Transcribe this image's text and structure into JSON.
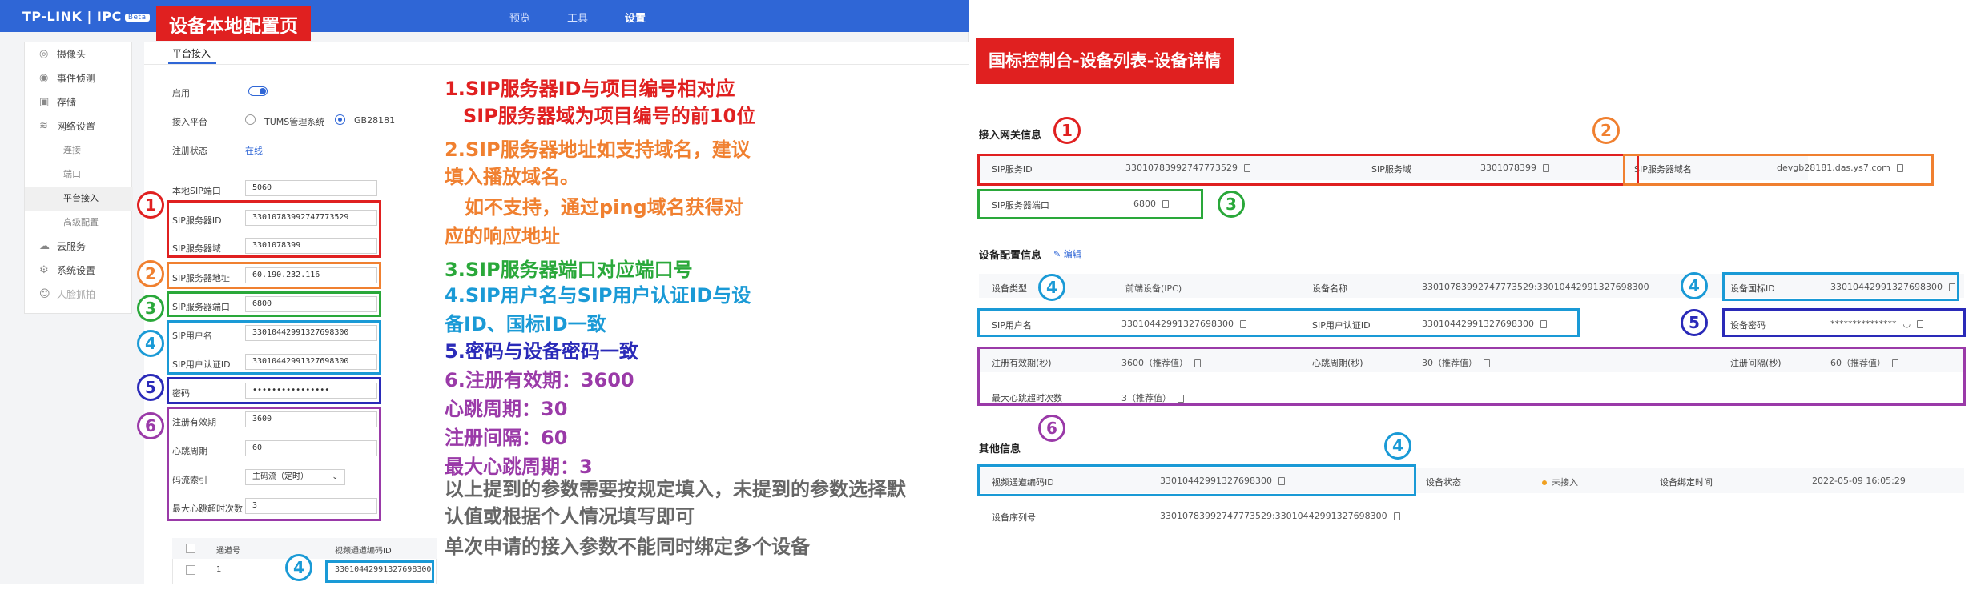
{
  "left": {
    "logo": "TP-LINK | IPC",
    "logo_badge": "Beta",
    "nav": [
      "预览",
      "工具",
      "设置"
    ],
    "title": "设备本地配置页",
    "sidebar": [
      "摄像头",
      "事件侦测",
      "存储",
      "网络设置",
      "连接",
      "端口",
      "平台接入",
      "高级配置",
      "云服务",
      "系统设置",
      "人脸抓拍"
    ],
    "tab": "平台接入",
    "fields": {
      "enable": "启用",
      "platform": "接入平台",
      "platform_opt1": "TUMS管理系统",
      "platform_opt2": "GB28181",
      "reg_status": "注册状态",
      "reg_status_value": "在线",
      "local_port": "本地SIP端口",
      "local_port_value": "5060",
      "sip_id": "SIP服务器ID",
      "sip_id_value": "33010783992747773529",
      "sip_domain": "SIP服务器域",
      "sip_domain_value": "3301078399",
      "sip_addr": "SIP服务器地址",
      "sip_addr_value": "60.190.232.116",
      "sip_port": "SIP服务器端口",
      "sip_port_value": "6800",
      "sip_user": "SIP用户名",
      "sip_user_value": "33010442991327698300",
      "sip_auth": "SIP用户认证ID",
      "sip_auth_value": "33010442991327698300",
      "password": "密码",
      "password_value": "••••••••••••••••",
      "reg_valid": "注册有效期",
      "reg_valid_value": "3600",
      "heartbeat": "心跳周期",
      "heartbeat_value": "60",
      "stream": "码流索引",
      "stream_value": "主码流（定时）",
      "max_hb": "最大心跳超时次数",
      "max_hb_value": "3"
    },
    "channel_table": {
      "col1": "通道号",
      "col2": "视频通道编码ID",
      "row_no": "1",
      "row_id": "33010442991327698300"
    },
    "notes": [
      "1.SIP服务器ID与项目编号相对应",
      "SIP服务器域为项目编号的前10位",
      "2.SIP服务器地址如支持域名，建议",
      "填入播放域名。",
      "如不支持，通过ping域名获得对",
      "应的响应地址",
      "3.SIP服务器端口对应端口号",
      "4.SIP用户名与SIP用户认证ID与设",
      "备ID、国标ID一致",
      "5.密码与设备密码一致",
      "6.注册有效期：3600",
      "心跳周期：30",
      "注册间隔：60",
      "最大心跳周期：3",
      "以上提到的参数需要按规定填入，未提到的参数选择默",
      "认值或根据个人情况填写即可",
      "单次申请的接入参数不能同时绑定多个设备"
    ],
    "markers": [
      "1",
      "2",
      "3",
      "4",
      "5",
      "6",
      "4"
    ]
  },
  "right": {
    "title": "国标控制台-设备列表-设备详情",
    "sections": {
      "access": "接入网关信息",
      "config": "设备配置信息",
      "edit": "编辑",
      "other": "其他信息"
    },
    "access": {
      "sip_id_label": "SIP服务ID",
      "sip_id_value": "33010783992747773529",
      "sip_domain_label": "SIP服务域",
      "sip_domain_value": "3301078399",
      "sip_dn_label": "SIP服务器域名",
      "sip_dn_value": "devgb28181.das.ys7.com",
      "sip_port_label": "SIP服务器端口",
      "sip_port_value": "6800"
    },
    "config": {
      "type_label": "设备类型",
      "type_value": "前端设备(IPC)",
      "name_label": "设备名称",
      "name_value": "33010783992747773529:33010442991327698300",
      "gbid_label": "设备国标ID",
      "gbid_value": "33010442991327698300",
      "user_label": "SIP用户名",
      "user_value": "33010442991327698300",
      "auth_label": "SIP用户认证ID",
      "auth_value": "33010442991327698300",
      "pwd_label": "设备密码",
      "pwd_value": "***************",
      "valid_label": "注册有效期(秒)",
      "valid_value": "3600（推荐值）",
      "hb_label": "心跳周期(秒)",
      "hb_value": "30（推荐值）",
      "interval_label": "注册间隔(秒)",
      "interval_value": "60（推荐值）",
      "maxhb_label": "最大心跳超时次数",
      "maxhb_value": "3（推荐值）"
    },
    "other": {
      "chan_label": "视频通道编码ID",
      "chan_value": "33010442991327698300",
      "status_label": "设备状态",
      "status_value": "未接入",
      "bind_label": "设备绑定时间",
      "bind_value": "2022-05-09 16:05:29",
      "serial_label": "设备序列号",
      "serial_value": "33010783992747773529:33010442991327698300"
    },
    "markers": [
      "1",
      "2",
      "3",
      "4",
      "4",
      "5",
      "6",
      "4"
    ]
  },
  "colors": {
    "red": "#e02020",
    "orange": "#f08030",
    "green": "#2aa83a",
    "blue": "#1a9ad6",
    "navy": "#2a2ab8",
    "purple": "#9a3aa8",
    "topbar": "#2f66d6"
  }
}
